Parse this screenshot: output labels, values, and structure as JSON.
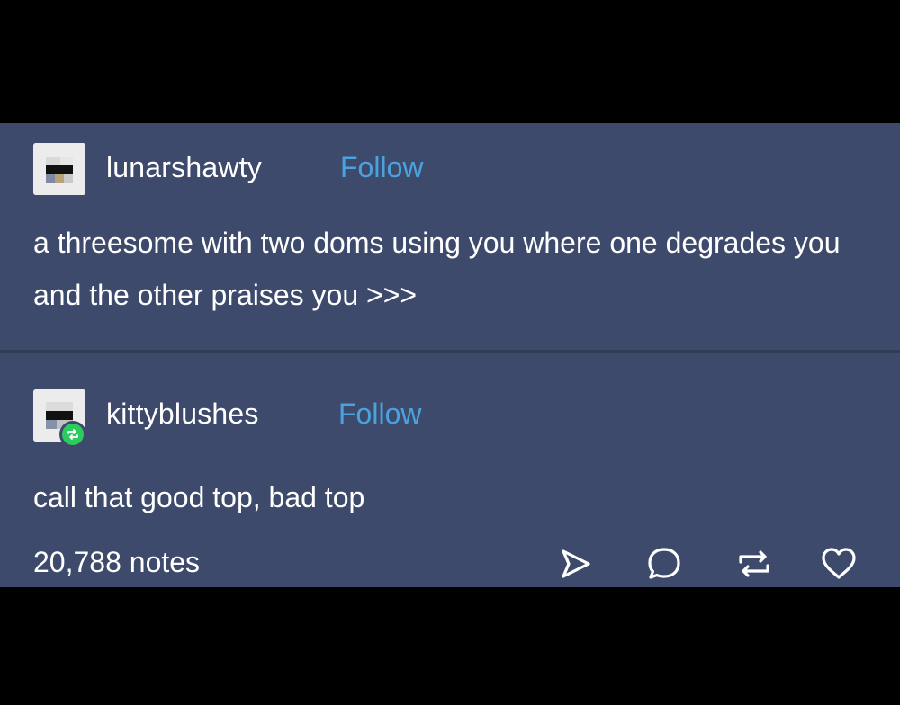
{
  "posts": [
    {
      "username": "lunarshawty",
      "follow_label": "Follow",
      "text": "a threesome with two doms using you where one degrades you and the other praises you >>>",
      "avatar": "pixelated-avatar"
    },
    {
      "username": "kittyblushes",
      "follow_label": "Follow",
      "text": "call that good top, bad top",
      "avatar": "pixelated-avatar",
      "badge": "reblog-icon"
    }
  ],
  "footer": {
    "notes": "20,788 notes",
    "actions": [
      "share-icon",
      "comment-icon",
      "reblog-icon",
      "heart-icon"
    ]
  },
  "colors": {
    "background": "#3e4a6b",
    "text": "#ffffff",
    "follow": "#4aa3df",
    "badge": "#2bcb5f"
  }
}
